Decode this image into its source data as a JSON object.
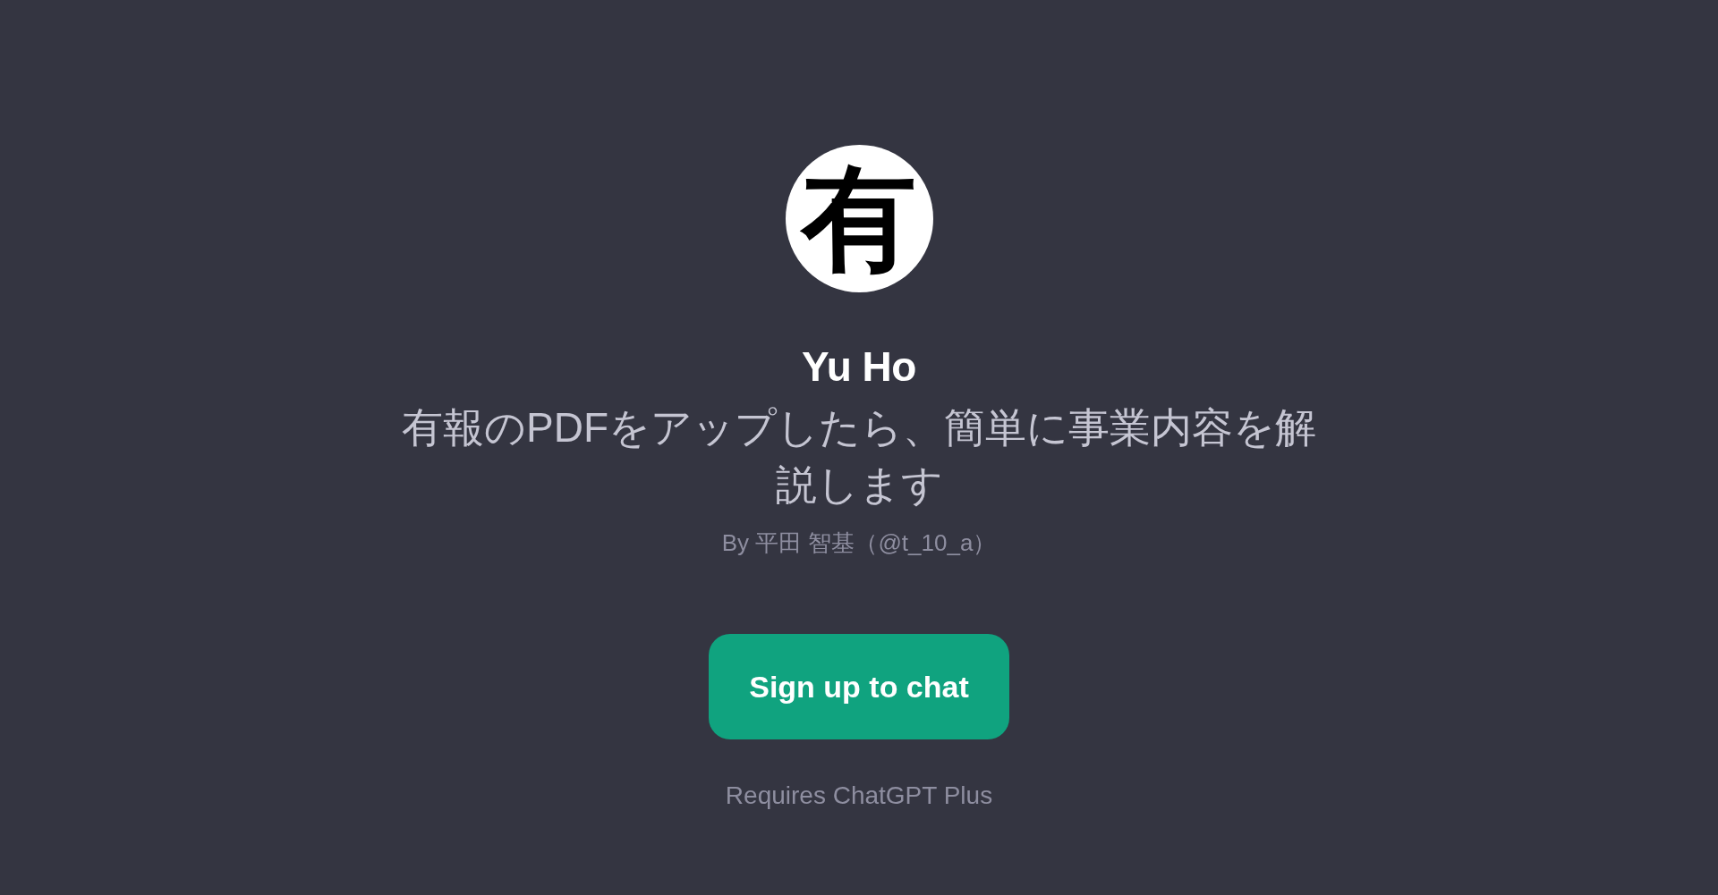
{
  "logo": {
    "glyph": "有"
  },
  "title": "Yu Ho",
  "description": "有報のPDFをアップしたら、簡単に事業内容を解説します",
  "author": "By 平田 智基（@t_10_a）",
  "button": {
    "label": "Sign up to chat"
  },
  "note": "Requires ChatGPT Plus"
}
